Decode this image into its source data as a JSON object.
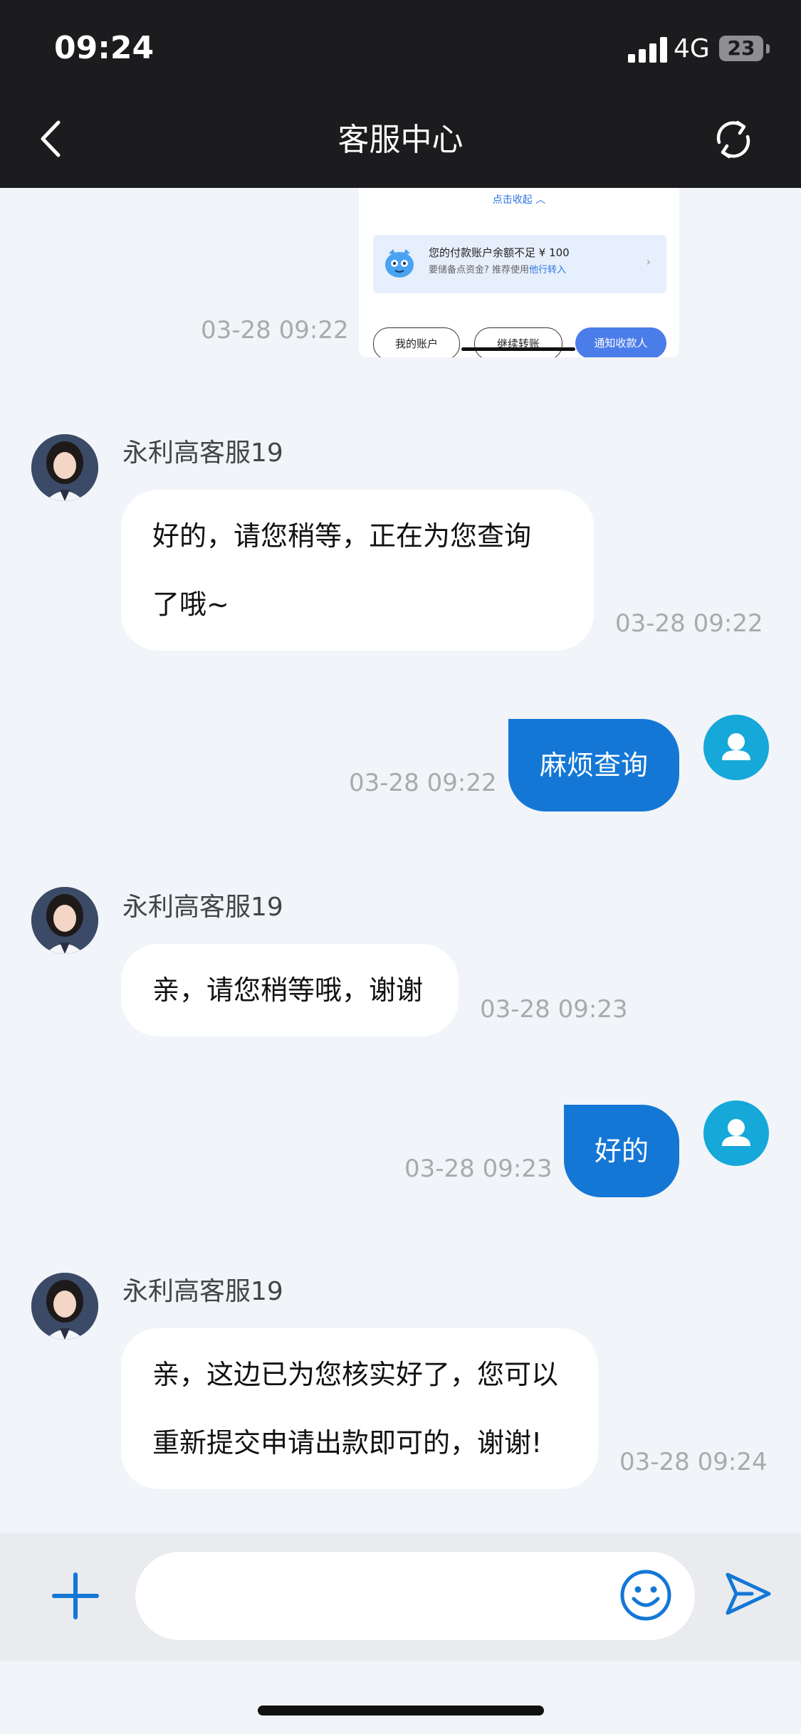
{
  "status_bar": {
    "time": "09:24",
    "network": "4G",
    "battery": "23"
  },
  "header": {
    "title": "客服中心"
  },
  "embedded_card": {
    "collapse_label": "点击收起 ︿",
    "alert_title": "您的付款账户余额不足 ¥ 100",
    "alert_subtitle": "要储备点资金? 推荐使用",
    "alert_link": "他行转入",
    "buttons": [
      "我的账户",
      "继续转账",
      "通知收款人"
    ],
    "timestamp": "03-28 09:22"
  },
  "messages": [
    {
      "sender": "永利高客服19",
      "lines": [
        "好的，请您稍等，正在为您查询",
        "了哦~"
      ],
      "time": "03-28 09:22"
    },
    {
      "text": "麻烦查询",
      "time": "03-28 09:22"
    },
    {
      "sender": "永利高客服19",
      "lines": [
        "亲，请您稍等哦，谢谢"
      ],
      "time": "03-28 09:23"
    },
    {
      "text": "好的",
      "time": "03-28 09:23"
    },
    {
      "sender": "永利高客服19",
      "lines": [
        "亲，这边已为您核实好了，您可以",
        "重新提交申请出款即可的，谢谢!"
      ],
      "time": "03-28 09:24"
    }
  ],
  "input": {
    "value": "",
    "placeholder": ""
  },
  "colors": {
    "outgoing_bubble": "#1477d6",
    "user_avatar": "#15a8d8",
    "header_bg": "#1c1c1e"
  }
}
